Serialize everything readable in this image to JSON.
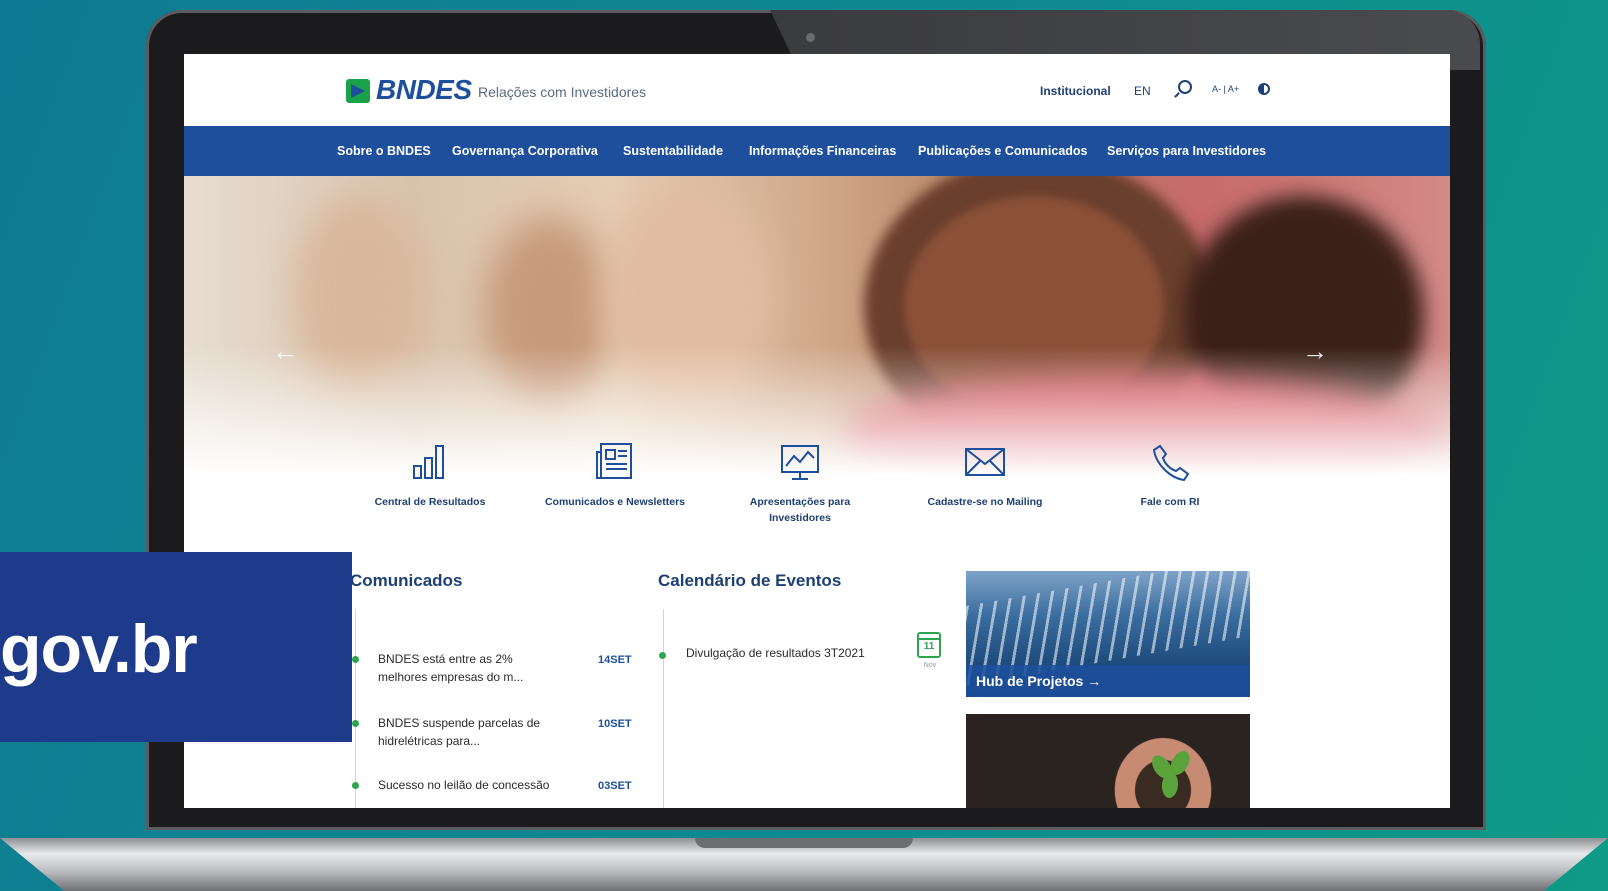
{
  "header": {
    "logo_text": "BNDES",
    "subtitle": "Relações com Investidores",
    "links": {
      "institucional": "Institucional",
      "lang": "EN",
      "font_size": "A- | A+"
    }
  },
  "nav": {
    "items": [
      {
        "label": "Sobre o BNDES"
      },
      {
        "label": "Governança Corporativa"
      },
      {
        "label": "Sustentabilidade"
      },
      {
        "label": "Informações Financeiras"
      },
      {
        "label": "Publicações e Comunicados"
      },
      {
        "label": "Serviços para Investidores"
      }
    ]
  },
  "hero": {
    "prev": "←",
    "next": "→"
  },
  "quick_links": [
    {
      "label": "Central de Resultados",
      "icon": "bar-chart-icon"
    },
    {
      "label": "Comunicados e Newsletters",
      "icon": "newspaper-icon"
    },
    {
      "label": "Apresentações para Investidores",
      "icon": "presentation-icon"
    },
    {
      "label": "Cadastre-se no Mailing",
      "icon": "envelope-icon"
    },
    {
      "label": "Fale com RI",
      "icon": "phone-icon"
    }
  ],
  "comunicados": {
    "title": "Comunicados",
    "items": [
      {
        "text": "BNDES está entre as 2% melhores empresas do m...",
        "date": "14SET"
      },
      {
        "text": "BNDES suspende parcelas de hidrelétricas para...",
        "date": "10SET"
      },
      {
        "text": "Sucesso no leilão de concessão",
        "date": "03SET"
      }
    ]
  },
  "eventos": {
    "title": "Calendário de Eventos",
    "items": [
      {
        "text": "Divulgação de resultados 3T2021",
        "day": "11",
        "month": "Nov"
      }
    ]
  },
  "cards": {
    "hub": "Hub de Projetos  →"
  },
  "overlay": {
    "text": "gov.br"
  },
  "colors": {
    "brand_blue": "#1d4f9c",
    "accent_green": "#2ea44f",
    "overlay_blue": "#1e3a8a"
  }
}
